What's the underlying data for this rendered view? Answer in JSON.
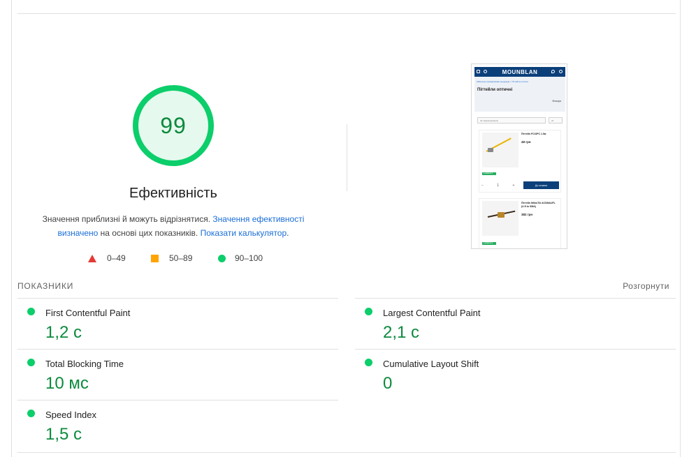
{
  "score": {
    "value": "99",
    "fraction": 0.99,
    "color": "#0cce6b"
  },
  "category_title": "Ефективність",
  "note": {
    "prefix": "Значення приблизні й можуть відрізнятися. ",
    "link1": "Значення ефективності визначено",
    "middle": " на основі цих показників. ",
    "link2": "Показати калькулятор",
    "suffix": "."
  },
  "legend": [
    {
      "label": "0–49",
      "color": "#e53935"
    },
    {
      "label": "50–89",
      "color": "#ffa400"
    },
    {
      "label": "90–100",
      "color": "#0cce6b"
    }
  ],
  "thumbnail": {
    "brand": "MOUNBLAN",
    "breadcrumb": "Кабельно-провідникова продукція > Пігтейли оптичні",
    "page_title": "Пігтейли оптичні",
    "filter_label": "Фільтри",
    "sort_label": "За замовчуванням",
    "per_page": "24",
    "products": [
      {
        "name": "Пігтейл FC/UPC 1.5м",
        "price": "48 грн",
        "badge": "в наявності"
      },
      {
        "name": "Пігтейл MikroTik ACSMAUFL (U.fl to SMA)",
        "price": "382 грн",
        "badge": "в наявності"
      }
    ],
    "qty": "− 1 +",
    "buy_label": "До кошика"
  },
  "metrics_section": {
    "heading": "ПОКАЗНИКИ",
    "expand_label": "Розгорнути",
    "items": [
      {
        "name": "First Contentful Paint",
        "value": "1,2 с"
      },
      {
        "name": "Largest Contentful Paint",
        "value": "2,1 с"
      },
      {
        "name": "Total Blocking Time",
        "value": "10 мс"
      },
      {
        "name": "Cumulative Layout Shift",
        "value": "0"
      },
      {
        "name": "Speed Index",
        "value": "1,5 с"
      }
    ]
  }
}
